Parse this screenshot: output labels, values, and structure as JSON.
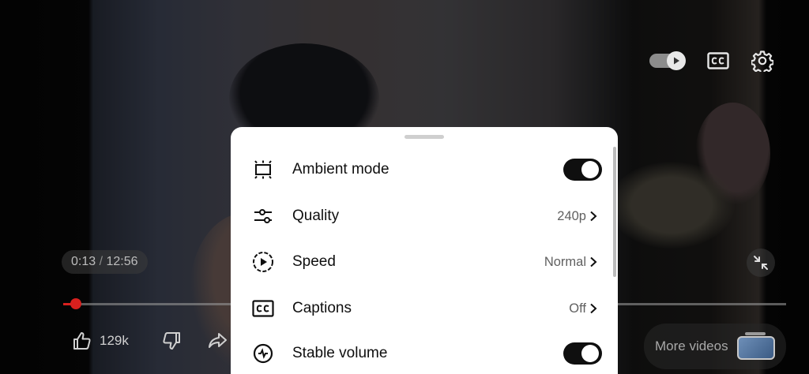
{
  "player": {
    "time_current": "0:13",
    "time_separator": "/",
    "time_total": "12:56",
    "progress_fraction": 0.017,
    "autoplay_on": true,
    "like_count": "129k",
    "more_videos_label": "More videos",
    "accent_color": "#d8201e"
  },
  "top_icons": [
    "autoplay-toggle",
    "closed-captions-icon",
    "gear-icon"
  ],
  "settings_sheet": {
    "items": [
      {
        "label": "Ambient mode",
        "icon": "ambient-mode-icon",
        "control": "switch",
        "on": true
      },
      {
        "label": "Quality",
        "icon": "sliders-icon",
        "value": "240p"
      },
      {
        "label": "Speed",
        "icon": "playback-speed-icon",
        "value": "Normal"
      },
      {
        "label": "Captions",
        "icon": "captions-icon",
        "value": "Off"
      },
      {
        "label": "Stable volume",
        "icon": "stable-volume-icon",
        "control": "switch",
        "on": true
      }
    ]
  }
}
